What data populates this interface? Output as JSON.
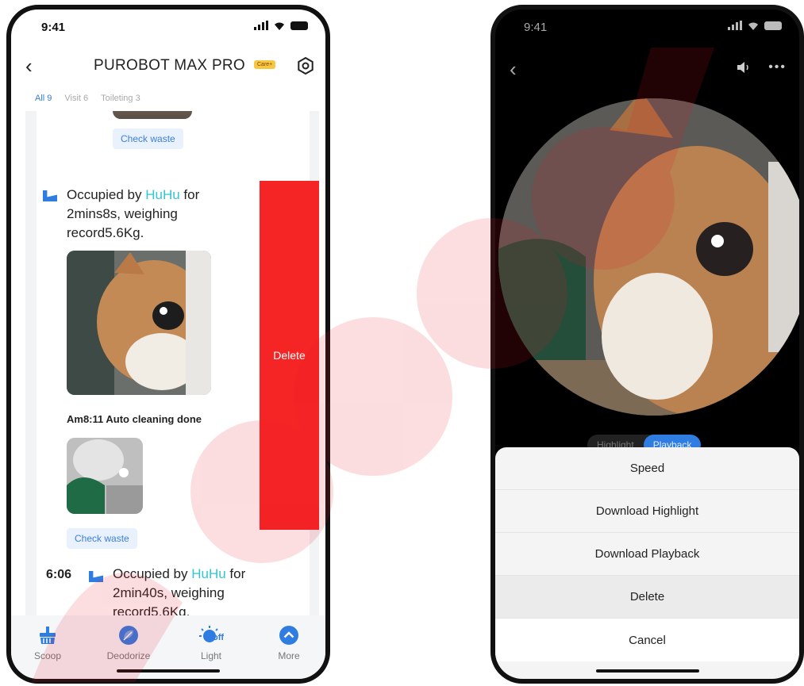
{
  "left_screen": {
    "status_time": "9:41",
    "header": {
      "title": "PUROBOT MAX PRO",
      "badge": "Care+"
    },
    "tabs": [
      {
        "label": "All 9",
        "active": true
      },
      {
        "label": "Visit 6",
        "active": false
      },
      {
        "label": "Toileting 3",
        "active": false
      }
    ],
    "feed": {
      "check_waste_1": "Check waste",
      "entry1": {
        "prefix": "Occupied by ",
        "cat": "HuHu",
        "suffix": " for",
        "line2": "2mins8s, weighing",
        "line3": "record5.6Kg."
      },
      "cleaning": "Am8:11 Auto cleaning done",
      "check_waste_2": "Check waste",
      "entry2": {
        "time": "6:06",
        "prefix": "Occupied by ",
        "cat": "HuHu",
        "suffix": " for",
        "line2": "2min40s, weighing",
        "line3": "record5.6Kg."
      }
    },
    "delete_label": "Delete",
    "nav": [
      {
        "label": "Scoop",
        "icon": "scoop-icon"
      },
      {
        "label": "Deodorize",
        "icon": "leaf-icon"
      },
      {
        "label": "Light",
        "icon": "light-off-icon",
        "icon_text": "off"
      },
      {
        "label": "More",
        "icon": "chevron-up-circle-icon"
      }
    ],
    "colors": {
      "accent": "#2f7de1",
      "highlight": "#32c5d2",
      "delete": "#f52525"
    }
  },
  "right_screen": {
    "status_time": "9:41",
    "segment": [
      {
        "label": "Highlight",
        "active": false
      },
      {
        "label": "Playback",
        "active": true
      }
    ],
    "sheet": {
      "items": [
        "Speed",
        "Download Highlight",
        "Download Playback",
        "Delete"
      ],
      "cancel": "Cancel"
    }
  }
}
